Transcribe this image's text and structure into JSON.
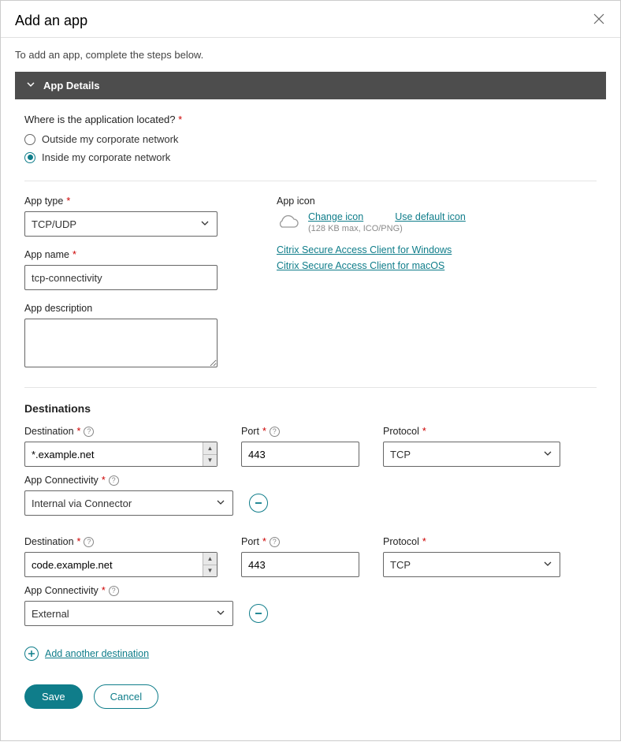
{
  "modal": {
    "title": "Add an app",
    "intro": "To add an app, complete the steps below."
  },
  "section": {
    "title": "App Details"
  },
  "location": {
    "question": "Where is the application located?",
    "outside": "Outside my corporate network",
    "inside": "Inside my corporate network"
  },
  "fields": {
    "app_type_label": "App type",
    "app_type_value": "TCP/UDP",
    "app_name_label": "App name",
    "app_name_value": "tcp-connectivity",
    "app_desc_label": "App description",
    "app_desc_value": ""
  },
  "icon": {
    "label": "App icon",
    "change": "Change icon",
    "default": "Use default icon",
    "hint": "(128 KB max, ICO/PNG)",
    "win_link": "Citrix Secure Access Client for Windows",
    "mac_link": "Citrix Secure Access Client for macOS"
  },
  "dest": {
    "heading": "Destinations",
    "destination_label": "Destination",
    "port_label": "Port",
    "protocol_label": "Protocol",
    "connectivity_label": "App Connectivity",
    "add_another": "Add another destination",
    "rows": [
      {
        "destination": "*.example.net",
        "port": "443",
        "protocol": "TCP",
        "connectivity": "Internal via Connector"
      },
      {
        "destination": "code.example.net",
        "port": "443",
        "protocol": "TCP",
        "connectivity": "External"
      }
    ]
  },
  "buttons": {
    "save": "Save",
    "cancel": "Cancel"
  }
}
